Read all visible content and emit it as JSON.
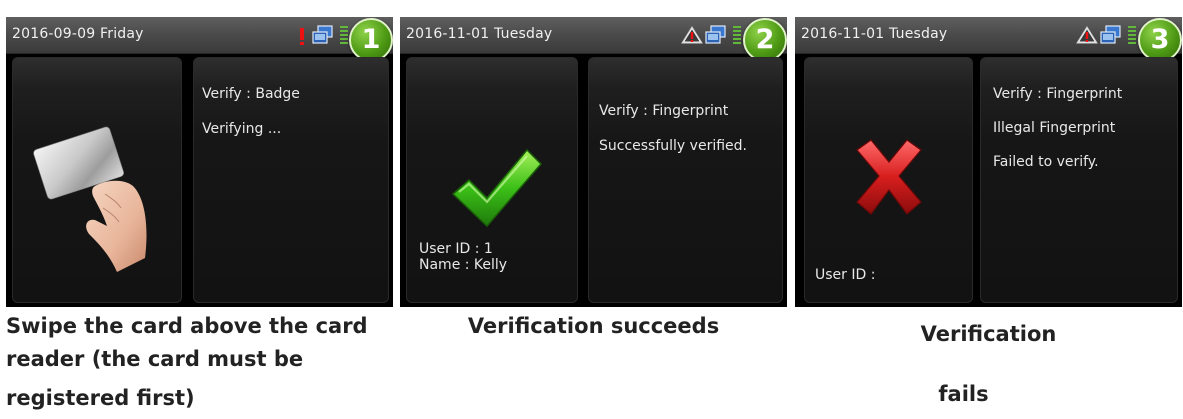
{
  "screens": [
    {
      "number": "1",
      "date": "2016-09-09  Friday",
      "status_icons": [
        "alert-icon",
        "network-icon",
        "signal-icon"
      ],
      "right_lines": [
        "Verify : Badge",
        "Verifying ..."
      ],
      "left_lines": [],
      "image": "hand-holding-card",
      "caption_lines": [
        "Swipe the card above the card",
        "reader (the card must be",
        "registered first)"
      ]
    },
    {
      "number": "2",
      "date": "2016-11-01  Tuesday",
      "status_icons": [
        "warning-triangle-icon",
        "network-icon",
        "signal-icon"
      ],
      "right_lines": [
        "Verify : Fingerprint",
        "Successfully verified."
      ],
      "left_lines": [
        "User ID : 1",
        "Name : Kelly"
      ],
      "image": "check-mark",
      "caption_lines": [
        "Verification succeeds"
      ]
    },
    {
      "number": "3",
      "date": "2016-11-01  Tuesday",
      "status_icons": [
        "warning-triangle-icon",
        "network-icon",
        "signal-icon"
      ],
      "right_lines": [
        "Verify : Fingerprint",
        "Illegal Fingerprint",
        "Failed to verify."
      ],
      "left_lines": [
        "User ID :"
      ],
      "image": "cross-mark",
      "caption_lines": [
        "Verification",
        "fails"
      ]
    }
  ],
  "colors": {
    "badge_green": "#4e9a14",
    "success_green": "#3cc018",
    "fail_red": "#d81e1e",
    "warning_red": "#ee1111"
  }
}
